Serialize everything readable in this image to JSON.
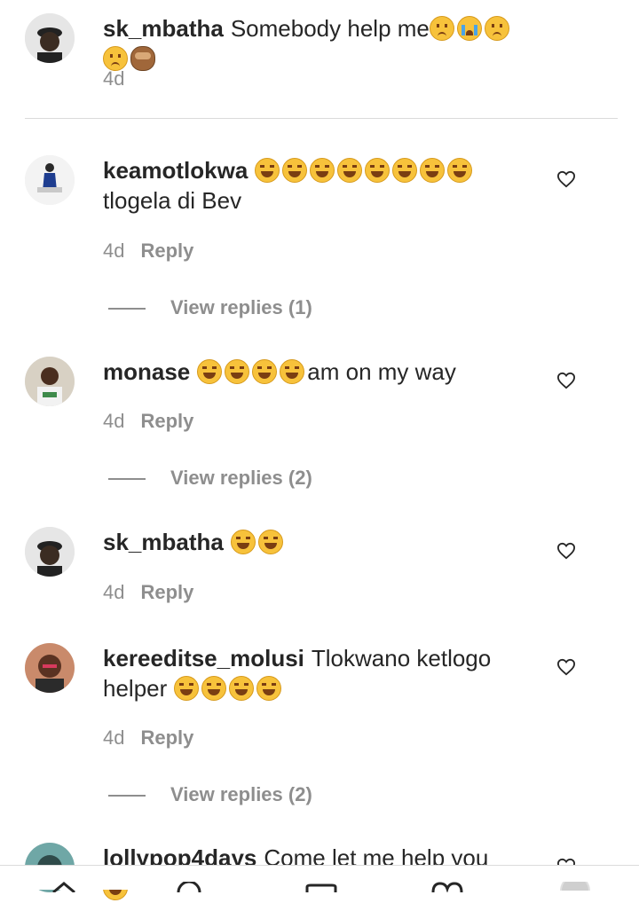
{
  "comments": [
    {
      "username": "sk_mbatha",
      "text": "Somebody help me",
      "emojis": [
        "pleading",
        "loudly-crying",
        "sad",
        "sad",
        "see-no-evil-monkey"
      ],
      "time": "4d",
      "reply_label": ""
    },
    {
      "username": "keamotlokwa",
      "text_after": "tlogela di Bev",
      "emojis": [
        "joy",
        "joy",
        "joy",
        "joy",
        "joy",
        "joy",
        "joy",
        "joy"
      ],
      "time": "4d",
      "reply_label": "Reply",
      "view_replies": "View replies (1)"
    },
    {
      "username": "monase",
      "emojis": [
        "joy",
        "joy",
        "joy",
        "joy"
      ],
      "text_after": "am on my way",
      "time": "4d",
      "reply_label": "Reply",
      "view_replies": "View replies (2)"
    },
    {
      "username": "sk_mbatha",
      "emojis": [
        "joy",
        "joy"
      ],
      "time": "4d",
      "reply_label": "Reply"
    },
    {
      "username": "kereeditse_molusi",
      "text": "Tlokwano ketlogo helper",
      "emojis": [
        "joy",
        "joy",
        "joy",
        "joy"
      ],
      "time": "4d",
      "reply_label": "Reply",
      "view_replies": "View replies (2)"
    },
    {
      "username": "lollypop4days",
      "text": "Come let me help you",
      "emojis": [
        "joy"
      ]
    }
  ],
  "colors": {
    "text": "#262626",
    "muted": "#8e8e8e",
    "divider": "#dbdbdb"
  },
  "icons": {
    "like": "heart-outline-icon",
    "nav": [
      "home-icon",
      "search-icon",
      "add-post-icon",
      "activity-heart-icon",
      "profile-icon"
    ]
  }
}
